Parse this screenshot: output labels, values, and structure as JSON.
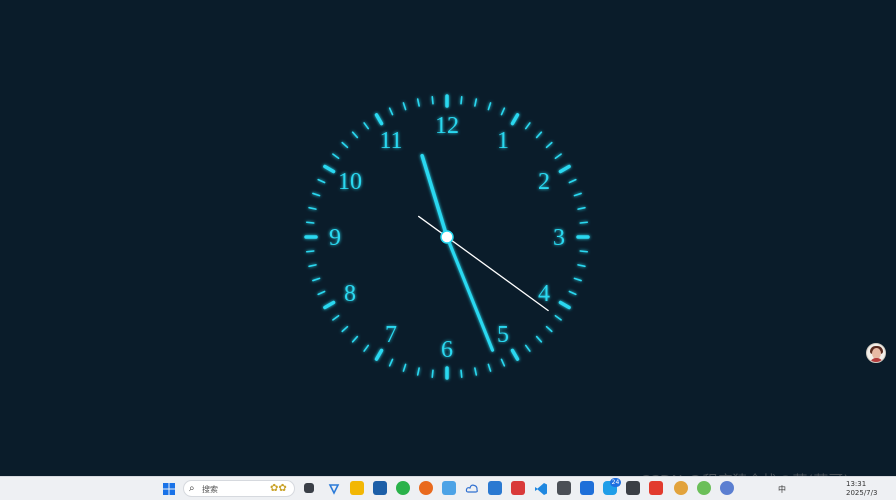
{
  "desktop": {
    "background_color": "#0a1c2a"
  },
  "clock": {
    "numerals": [
      "12",
      "1",
      "2",
      "3",
      "4",
      "5",
      "6",
      "7",
      "8",
      "9",
      "10",
      "11"
    ],
    "time_shown": {
      "hour": 11,
      "minute": 26,
      "second": 21
    },
    "accent_color": "#29d8f0",
    "second_hand_color": "#ffffff"
  },
  "floating_avatar": {
    "icon": "person-avatar-icon"
  },
  "taskbar": {
    "search_placeholder": "搜索",
    "search_icon": "search-icon",
    "apps": [
      "start-icon",
      "search-decoration-icon",
      "task-view-icon",
      "widgets-icon",
      "file-explorer-icon",
      "store-icon",
      "wechat-icon",
      "firefox-icon",
      "notepad-icon",
      "cloud-icon",
      "mail-icon",
      "app-red-icon",
      "vscode-icon",
      "app-dark-icon",
      "app-blue-icon",
      "chat-icon",
      "camera-icon",
      "pdf-icon"
    ],
    "badge_count": "24",
    "clock_time": "13:31",
    "clock_date": "2025/7/3",
    "ime_label": "中",
    "watermark": "CSDN @程序猿全栈の董(董哥)"
  }
}
